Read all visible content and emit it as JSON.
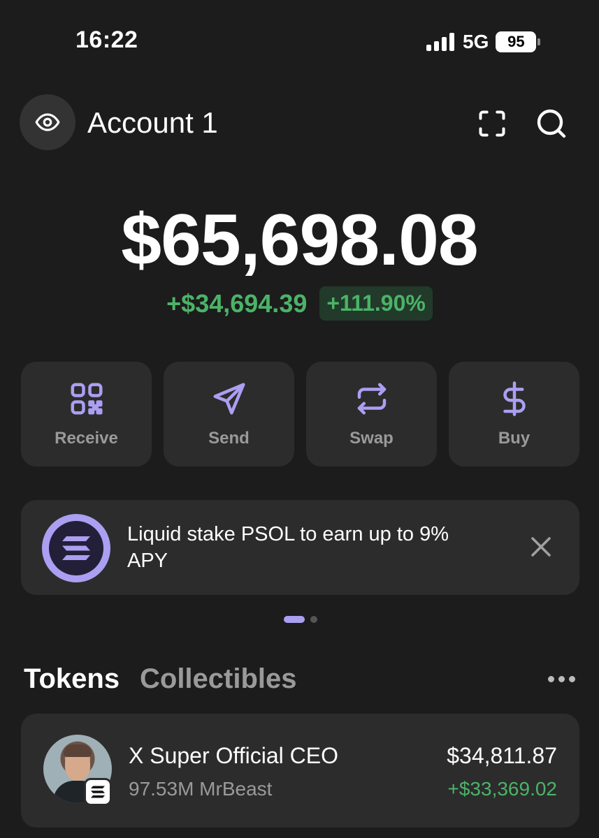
{
  "status_bar": {
    "time": "16:22",
    "network": "5G",
    "battery": "95"
  },
  "header": {
    "title": "Account 1",
    "icons": [
      "eye-icon",
      "scan-icon",
      "search-icon"
    ]
  },
  "portfolio": {
    "balance": "$65,698.08",
    "change_amount": "+$34,694.39",
    "change_percent": "+111.90%"
  },
  "actions": [
    {
      "label": "Receive",
      "icon": "qr-code-icon"
    },
    {
      "label": "Send",
      "icon": "paper-plane-icon"
    },
    {
      "label": "Swap",
      "icon": "swap-arrows-icon"
    },
    {
      "label": "Buy",
      "icon": "dollar-icon"
    }
  ],
  "promo": {
    "text": "Liquid stake PSOL to earn up to 9% APY",
    "icon": "solana-logo-icon"
  },
  "tabs": {
    "tokens": "Tokens",
    "collectibles": "Collectibles"
  },
  "tokens": [
    {
      "name": "X Super Official CEO",
      "amount": "97.53M MrBeast",
      "value": "$34,811.87",
      "change": "+$33,369.02"
    }
  ],
  "colors": {
    "background": "#1c1c1c",
    "card": "#2c2c2c",
    "accent": "#ab9ff2",
    "positive": "#4bb368"
  }
}
